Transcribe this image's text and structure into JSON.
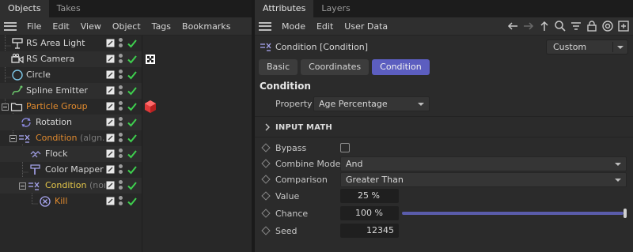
{
  "objects_panel": {
    "tabs": [
      {
        "label": "Objects",
        "active": true
      },
      {
        "label": "Takes",
        "active": false
      }
    ],
    "menu": [
      "File",
      "Edit",
      "View",
      "Object",
      "Tags",
      "Bookmarks"
    ],
    "rows": [
      {
        "name": "RS Area Light",
        "suffix": "",
        "color": "normal",
        "icon": "area-light-icon"
      },
      {
        "name": "RS Camera",
        "suffix": "",
        "color": "normal",
        "icon": "camera-icon",
        "tag": "target-tag-icon"
      },
      {
        "name": "Circle",
        "suffix": "",
        "color": "normal",
        "icon": "circle-spline-icon"
      },
      {
        "name": "Spline Emitter",
        "suffix": "",
        "color": "normal",
        "icon": "spline-emitter-icon"
      },
      {
        "name": "Particle Group",
        "suffix": "",
        "color": "orange",
        "icon": "folder-icon",
        "tag": "material-cube-icon"
      },
      {
        "name": "Rotation",
        "suffix": "",
        "color": "normal",
        "icon": "rotation-icon"
      },
      {
        "name": "Condition",
        "suffix": " (algn.z...",
        "color": "orange",
        "icon": "condition-icon"
      },
      {
        "name": "Flock",
        "suffix": "",
        "color": "normal",
        "icon": "flock-icon"
      },
      {
        "name": "Color Mapper",
        "suffix": "",
        "color": "normal",
        "icon": "color-mapper-icon"
      },
      {
        "name": "Condition",
        "suffix": " (non...",
        "color": "yellow",
        "icon": "condition-icon"
      },
      {
        "name": "Kill",
        "suffix": "",
        "color": "orange",
        "icon": "kill-icon"
      }
    ]
  },
  "attributes_panel": {
    "tabs": [
      {
        "label": "Attributes",
        "active": true
      },
      {
        "label": "Layers",
        "active": false
      }
    ],
    "menu": [
      "Mode",
      "Edit",
      "User Data"
    ],
    "title": "Condition [Condition]",
    "preset": "Custom",
    "subtabs": [
      {
        "label": "Basic",
        "active": false
      },
      {
        "label": "Coordinates",
        "active": false
      },
      {
        "label": "Condition",
        "active": true
      }
    ],
    "section_title": "Condition",
    "property": {
      "label": "Property",
      "value": "Age Percentage"
    },
    "group_title": "INPUT MATH",
    "fields": {
      "bypass": {
        "label": "Bypass",
        "checked": false
      },
      "combine_mode": {
        "label": "Combine Mode",
        "value": "And"
      },
      "comparison": {
        "label": "Comparison",
        "value": "Greater Than"
      },
      "value": {
        "label": "Value",
        "value": "25 %"
      },
      "chance": {
        "label": "Chance",
        "value": "100 %",
        "level": 1.0
      },
      "seed": {
        "label": "Seed",
        "value": "12345"
      }
    }
  },
  "colors": {
    "accent": "#5c5ec0",
    "check": "#3ecf4e",
    "orange": "#e08a2e",
    "yellow": "#e6c84a"
  }
}
